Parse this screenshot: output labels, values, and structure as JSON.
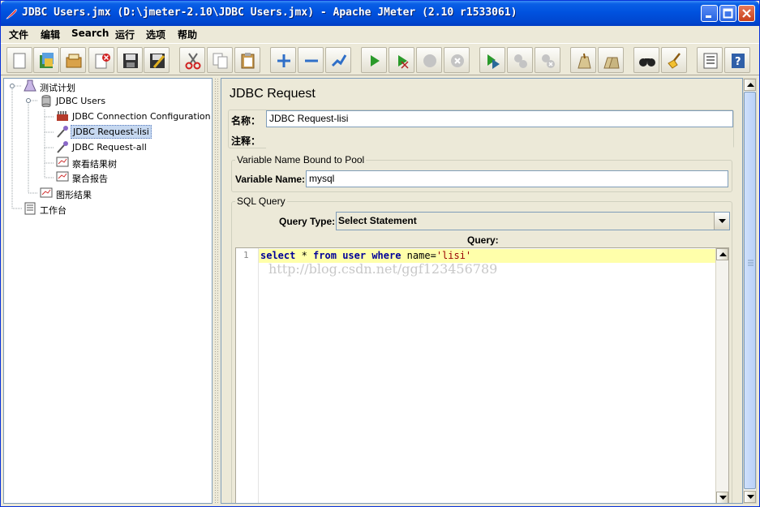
{
  "window": {
    "title": "JDBC Users.jmx (D:\\jmeter-2.10\\JDBC Users.jmx) - Apache JMeter (2.10 r1533061)"
  },
  "menu": [
    "文件",
    "编辑",
    "Search",
    "运行",
    "选项",
    "帮助"
  ],
  "toolbar": {
    "buttons": [
      "new-icon",
      "templates-icon",
      "open-icon",
      "close-file-icon",
      "save-icon",
      "save-as-icon",
      "cut-icon",
      "copy-icon",
      "paste-icon",
      "expand-icon",
      "collapse-icon",
      "toggle-icon",
      "start-icon",
      "start-no-pause-icon",
      "stop-icon",
      "shutdown-icon",
      "remote-start-icon",
      "remote-stop-icon",
      "remote-shutdown-icon",
      "clear-icon",
      "clear-all-icon",
      "search-icon",
      "reset-search-icon",
      "function-helper-icon",
      "help-icon"
    ]
  },
  "tree": {
    "items": [
      {
        "label": "测试计划",
        "icon": "test-plan-icon"
      },
      {
        "label": "JDBC Users",
        "icon": "thread-group-icon"
      },
      {
        "label": "JDBC Connection Configuration",
        "icon": "config-icon"
      },
      {
        "label": "JDBC Request-lisi",
        "icon": "sampler-icon",
        "selected": true
      },
      {
        "label": "JDBC Request-all",
        "icon": "sampler-icon"
      },
      {
        "label": "察看结果树",
        "icon": "listener-icon"
      },
      {
        "label": "聚合报告",
        "icon": "listener-icon"
      },
      {
        "label": "图形结果",
        "icon": "listener-icon"
      },
      {
        "label": "工作台",
        "icon": "workbench-icon"
      }
    ]
  },
  "panel": {
    "title": "JDBC Request",
    "name_label": "名称：",
    "name_value": "JDBC Request-lisi",
    "comment_label": "注释：",
    "comment_value": "",
    "pool_group_title": "Variable Name Bound to Pool",
    "variable_name_label": "Variable Name:",
    "variable_name_value": "mysql",
    "sql_group_title": "SQL Query",
    "query_type_label": "Query Type:",
    "query_type_value": "Select Statement",
    "query_label": "Query:",
    "query_line_number": "1",
    "query": {
      "kw1": "select",
      "t1": " * ",
      "kw2": "from",
      "t2": " ",
      "kw3": "user",
      "t3": " ",
      "kw4": "where",
      "t4": " name=",
      "str": "'lisi'"
    },
    "watermark": "http://blog.csdn.net/ggf123456789"
  }
}
